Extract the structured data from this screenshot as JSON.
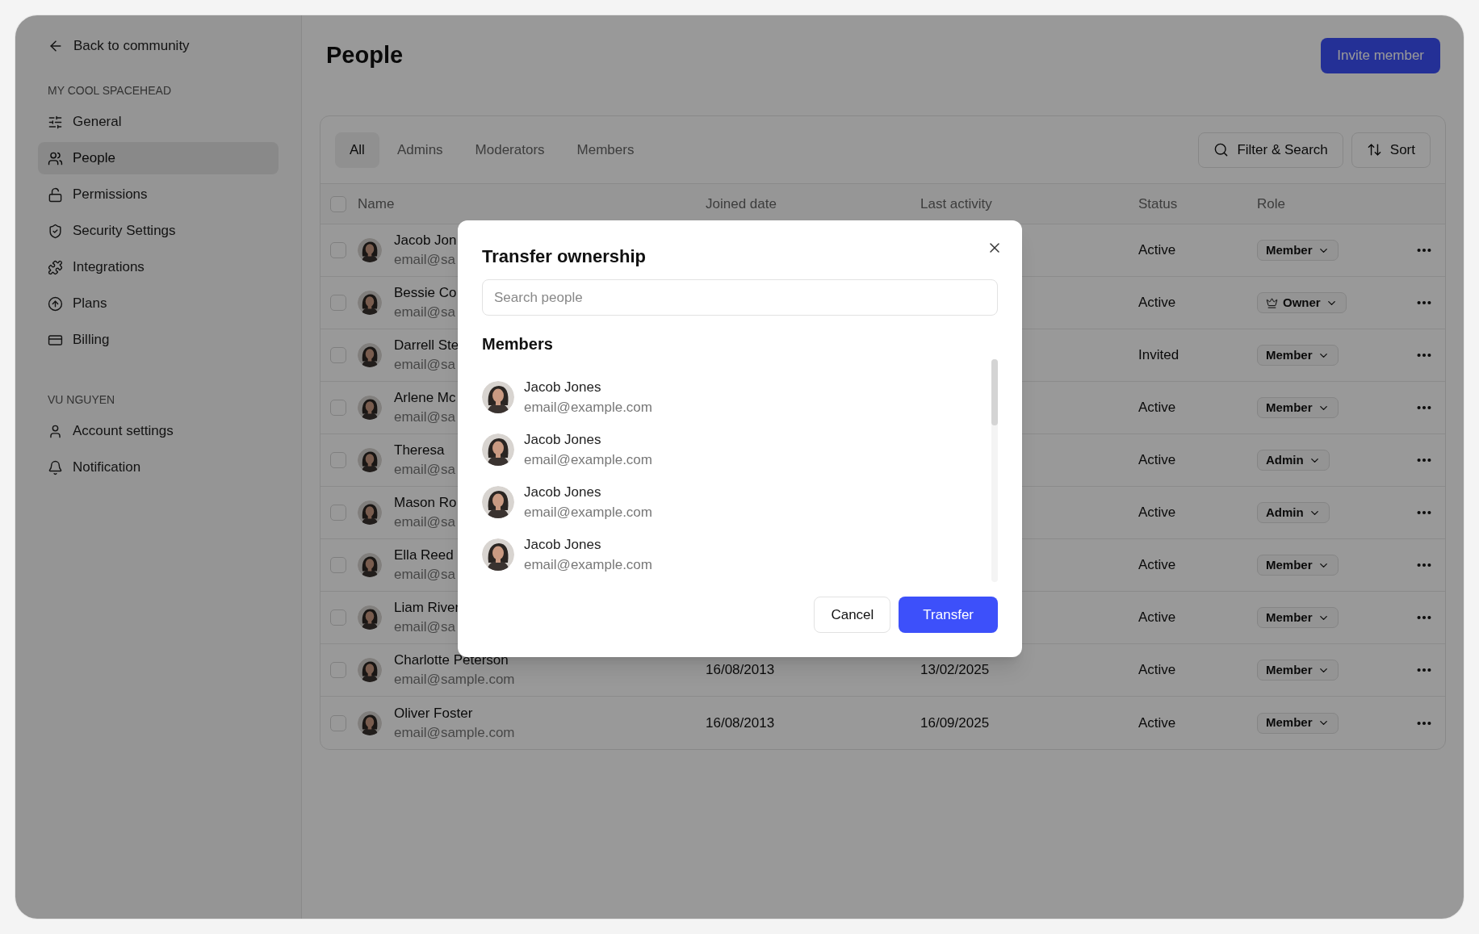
{
  "sidebar": {
    "back_link": "Back to community",
    "sections": [
      {
        "heading": "MY COOL SPACEHEAD",
        "items": [
          {
            "label": "General",
            "selected": false
          },
          {
            "label": "People",
            "selected": true
          },
          {
            "label": "Permissions",
            "selected": false
          },
          {
            "label": "Security Settings",
            "selected": false
          },
          {
            "label": "Integrations",
            "selected": false
          },
          {
            "label": "Plans",
            "selected": false
          },
          {
            "label": "Billing",
            "selected": false
          }
        ]
      },
      {
        "heading": "VU NGUYEN",
        "items": [
          {
            "label": "Account settings",
            "selected": false
          },
          {
            "label": "Notification",
            "selected": false
          }
        ]
      }
    ]
  },
  "page": {
    "title": "People",
    "invite_button": "Invite member"
  },
  "table": {
    "tabs": [
      {
        "label": "All",
        "selected": true
      },
      {
        "label": "Admins",
        "selected": false
      },
      {
        "label": "Moderators",
        "selected": false
      },
      {
        "label": "Members",
        "selected": false
      }
    ],
    "filter_button": "Filter & Search",
    "sort_button": "Sort",
    "select_all": {
      "checked": false
    },
    "columns": [
      "Name",
      "Joined date",
      "Last activity",
      "Status",
      "Role"
    ],
    "rows": [
      {
        "checked": false,
        "name": "Jacob Jon",
        "email": "email@sa",
        "status": "Active",
        "role": {
          "label": "Member",
          "kind": "plain"
        }
      },
      {
        "checked": false,
        "name": "Bessie Co",
        "email": "email@sa",
        "status": "Active",
        "role": {
          "label": "Owner",
          "kind": "owner"
        }
      },
      {
        "checked": false,
        "name": "Darrell Ste",
        "email": "email@sa",
        "status": "Invited",
        "role": {
          "label": "Member",
          "kind": "plain"
        }
      },
      {
        "checked": false,
        "name": "Arlene Mc",
        "email": "email@sa",
        "status": "Active",
        "role": {
          "label": "Member",
          "kind": "plain"
        }
      },
      {
        "checked": false,
        "name": "Theresa",
        "email": "email@sa",
        "status": "Active",
        "role": {
          "label": "Admin",
          "kind": "plain"
        }
      },
      {
        "checked": false,
        "name": "Mason Ro",
        "email": "email@sa",
        "status": "Active",
        "role": {
          "label": "Admin",
          "kind": "plain"
        }
      },
      {
        "checked": false,
        "name": "Ella Reed",
        "email": "email@sa",
        "status": "Active",
        "role": {
          "label": "Member",
          "kind": "plain"
        }
      },
      {
        "checked": false,
        "name": "Liam River",
        "email": "email@sa",
        "status": "Active",
        "role": {
          "label": "Member",
          "kind": "plain"
        }
      },
      {
        "checked": false,
        "name": "Charlotte Peterson",
        "email": "email@sample.com",
        "joined": "16/08/2013",
        "last_activity": "13/02/2025",
        "status": "Active",
        "role": {
          "label": "Member",
          "kind": "plain"
        }
      },
      {
        "checked": false,
        "name": "Oliver Foster",
        "email": "email@sample.com",
        "joined": "16/08/2013",
        "last_activity": "16/09/2025",
        "status": "Active",
        "role": {
          "label": "Member",
          "kind": "plain"
        }
      }
    ]
  },
  "dialog": {
    "title": "Transfer ownership",
    "search": {
      "placeholder": "Search people"
    },
    "section_heading": "Members",
    "members": [
      {
        "name": "Jacob Jones",
        "email": "email@example.com"
      },
      {
        "name": "Jacob Jones",
        "email": "email@example.com"
      },
      {
        "name": "Jacob Jones",
        "email": "email@example.com"
      },
      {
        "name": "Jacob Jones",
        "email": "email@example.com"
      }
    ],
    "cancel_button": "Cancel",
    "transfer_button": "Transfer"
  }
}
